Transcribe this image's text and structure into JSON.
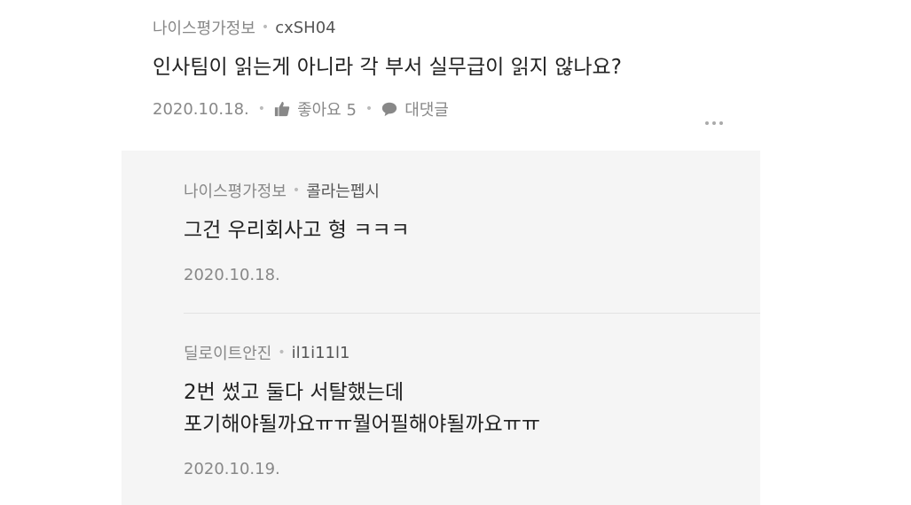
{
  "comment": {
    "company": "나이스평가정보",
    "user": "cxSH04",
    "text": "인사팀이 읽는게 아니라 각 부서 실무급이 읽지 않나요?",
    "date": "2020.10.18.",
    "like_label": "좋아요 5",
    "reply_label": "대댓글"
  },
  "replies": [
    {
      "company": "나이스평가정보",
      "user": "콜라는펩시",
      "text": "그건 우리회사고 형 ㅋㅋㅋ",
      "date": "2020.10.18."
    },
    {
      "company": "딜로이트안진",
      "user": "il1i11l1",
      "text_line1": "2번 썼고 둘다 서탈했는데",
      "text_line2": "포기해야될까요ㅠㅠ뭘어필해야될까요ㅠㅠ",
      "date": "2020.10.19."
    }
  ],
  "icons": {
    "like": "thumbs-up-icon",
    "reply": "speech-bubble-icon",
    "more": "more-dots-icon"
  }
}
